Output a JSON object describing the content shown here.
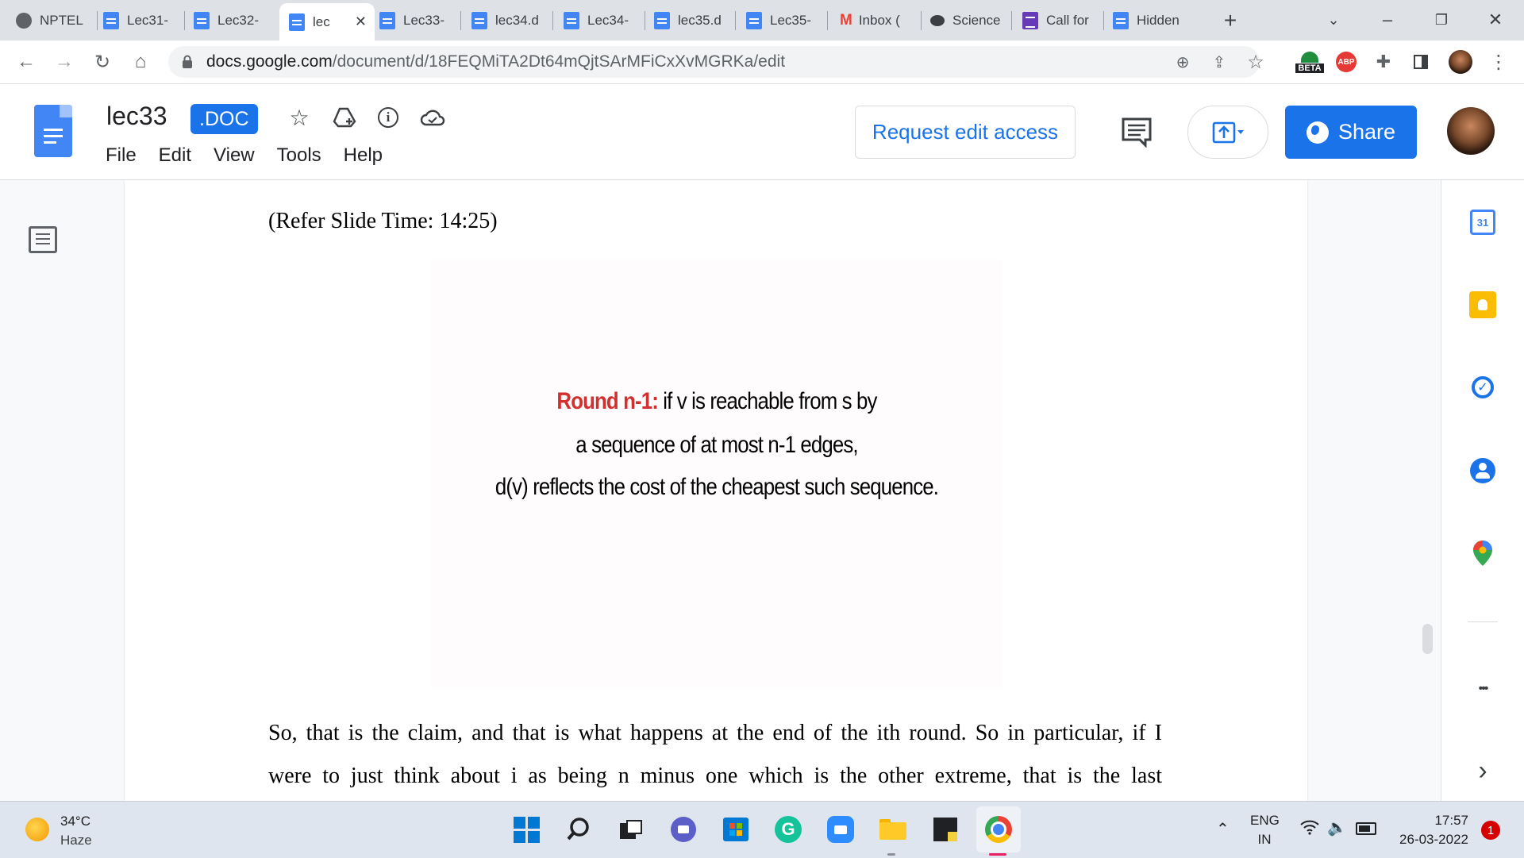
{
  "browser": {
    "tabs": [
      {
        "title": "NPTEL",
        "favicon": "globe-icon",
        "active": false
      },
      {
        "title": "Lec31-",
        "favicon": "docs-icon",
        "active": false
      },
      {
        "title": "Lec32-",
        "favicon": "docs-icon",
        "active": false
      },
      {
        "title": "lec",
        "favicon": "docs-icon",
        "active": true
      },
      {
        "title": "Lec33-",
        "favicon": "docs-icon",
        "active": false
      },
      {
        "title": "lec34.d",
        "favicon": "docs-icon",
        "active": false
      },
      {
        "title": "Lec34-",
        "favicon": "docs-icon",
        "active": false
      },
      {
        "title": "lec35.d",
        "favicon": "docs-icon",
        "active": false
      },
      {
        "title": "Lec35-",
        "favicon": "docs-icon",
        "active": false
      },
      {
        "title": "Inbox (",
        "favicon": "gmail-icon",
        "active": false
      },
      {
        "title": "Science",
        "favicon": "chat-icon",
        "active": false
      },
      {
        "title": "Call for",
        "favicon": "forms-icon",
        "active": false
      },
      {
        "title": "Hidden",
        "favicon": "docs-icon",
        "active": false
      }
    ],
    "close_glyph": "✕",
    "new_tab_glyph": "+",
    "url_host": "docs.google.com",
    "url_path": "/document/d/18FEQMiTA2Dt64mQjtSArMFiCxXvMGRKa/edit",
    "extensions": {
      "beta_label": "BETA",
      "abp_label": "ABP"
    }
  },
  "doc": {
    "title": "lec33",
    "badge": ".DOC",
    "menu": [
      "File",
      "Edit",
      "View",
      "Tools",
      "Help"
    ],
    "request_edit_label": "Request edit access",
    "share_label": "Share",
    "brand_color": "#1a73e8"
  },
  "content": {
    "refer": "(Refer Slide Time: 14:25)",
    "slide": {
      "highlight": "Round n-1:",
      "line1_rest": " if v is reachable from s by",
      "line2": "a sequence of at most n-1 edges,",
      "line3": "d(v) reflects the cost of the cheapest such sequence.",
      "highlight_color": "#d32f2f"
    },
    "paragraph_lines": [
      "So, that is the claim, and that is what happens at the end of the ith round. So in particular, if I",
      "were to just think about i as being n minus one which is the other extreme, that is the last"
    ]
  },
  "side_panel": {
    "calendar_day": "31",
    "more_glyph": "•••",
    "expand_glyph": "›"
  },
  "taskbar": {
    "weather_temp": "34°C",
    "weather_desc": "Haze",
    "lang_top": "ENG",
    "lang_bottom": "IN",
    "time": "17:57",
    "date": "26-03-2022",
    "notification_count": "1"
  }
}
